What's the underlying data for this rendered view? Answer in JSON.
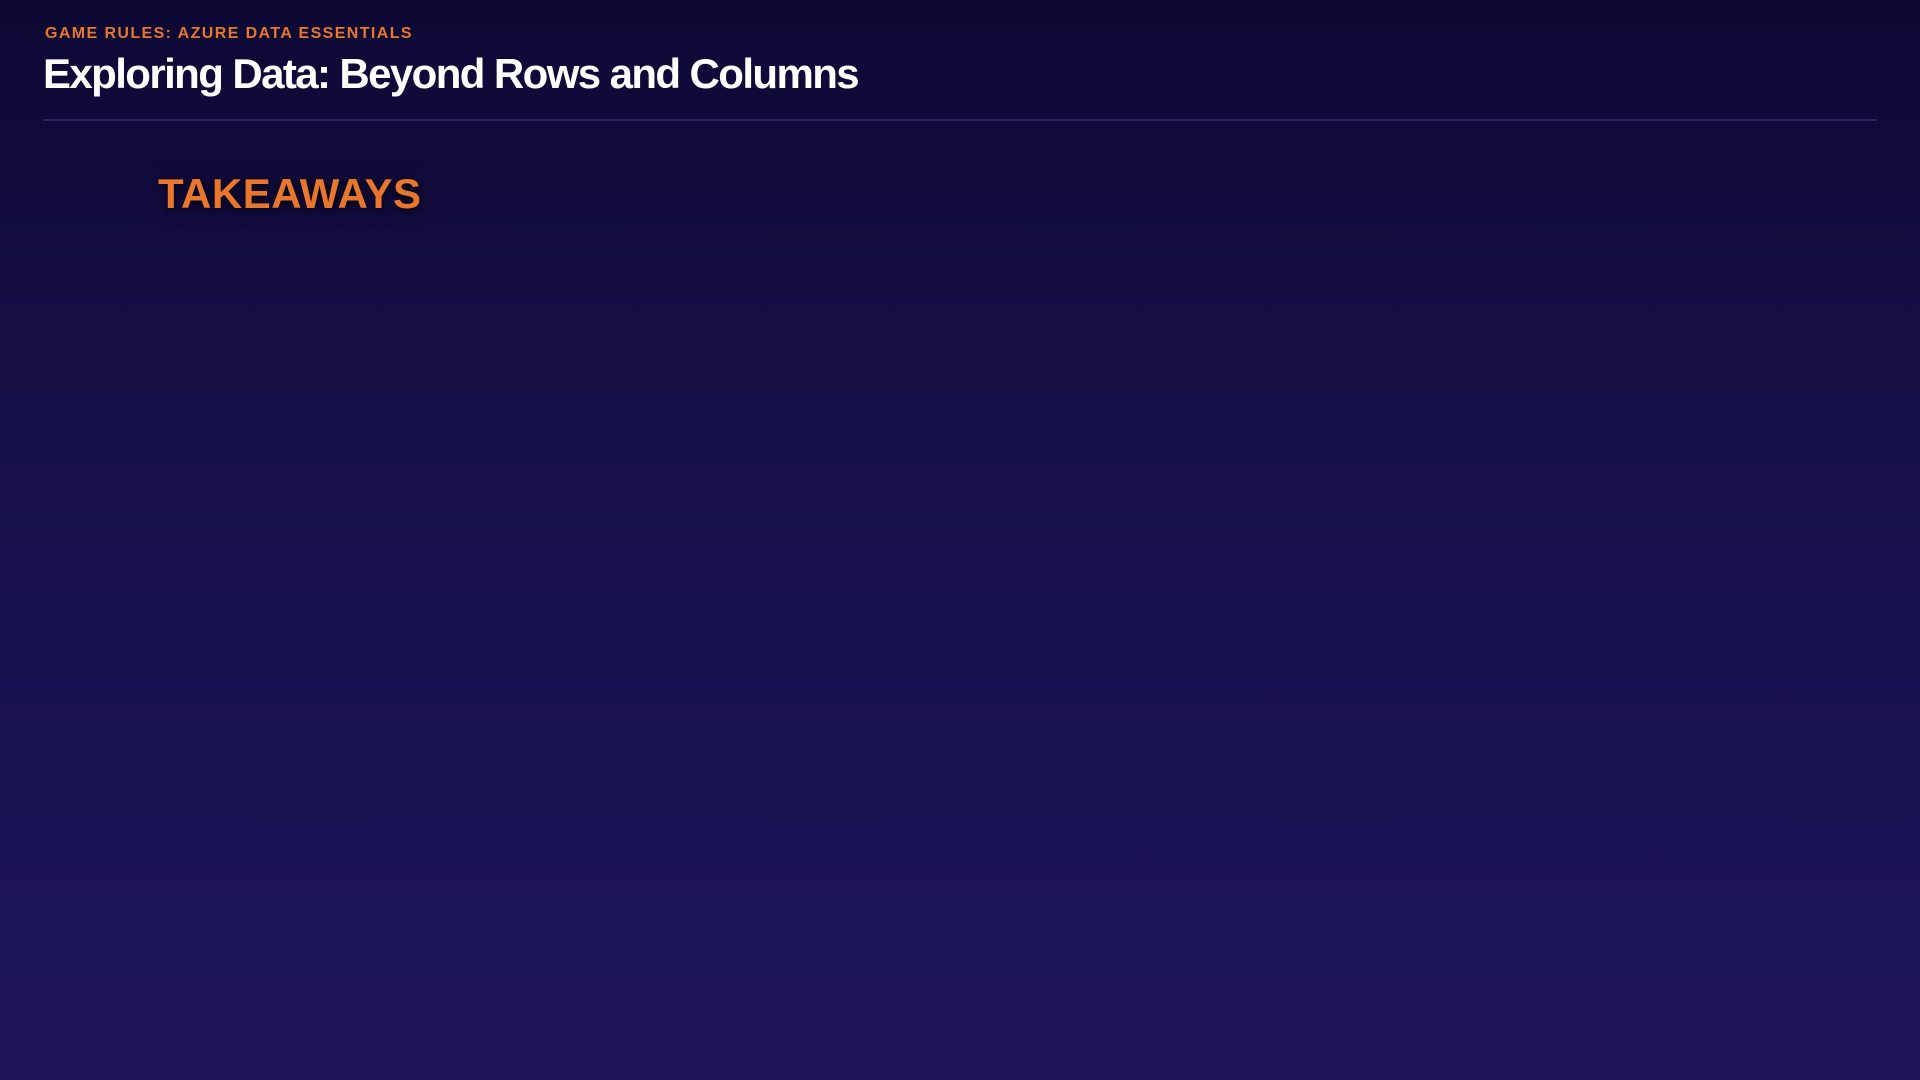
{
  "header": {
    "kicker": "GAME RULES: AZURE DATA ESSENTIALS",
    "title": "Exploring Data: Beyond Rows and Columns"
  },
  "section": {
    "heading": "TAKEAWAYS"
  },
  "colors": {
    "background_top": "#0d0833",
    "background_bottom": "#1c1457",
    "accent": "#e8762d",
    "title": "#ffffff",
    "divider": "#2a2462"
  }
}
